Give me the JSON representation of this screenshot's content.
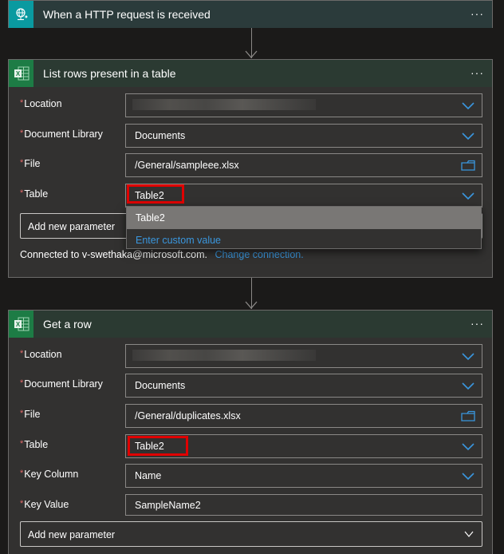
{
  "trigger": {
    "title": "When a HTTP request is received",
    "icon": "http-request-icon",
    "accent": "#0a9aa0",
    "more_label": "···"
  },
  "list_rows": {
    "title": "List rows present in a table",
    "icon": "excel-icon",
    "accent": "#1d7c45",
    "more_label": "···",
    "fields": {
      "location": {
        "label": "Location",
        "value": ""
      },
      "document_library": {
        "label": "Document Library",
        "value": "Documents"
      },
      "file": {
        "label": "File",
        "value": "/General/sampleee.xlsx"
      },
      "table": {
        "label": "Table",
        "value": "Table2"
      }
    },
    "dropdown": {
      "options": [
        "Table2"
      ],
      "custom": "Enter custom value"
    },
    "add_parameter": "Add new parameter",
    "connected_text": "Connected to v-swethaka@microsoft.com.",
    "change_connection": "Change connection."
  },
  "get_row": {
    "title": "Get a row",
    "icon": "excel-icon",
    "accent": "#1d7c45",
    "more_label": "···",
    "fields": {
      "location": {
        "label": "Location",
        "value": ""
      },
      "document_library": {
        "label": "Document Library",
        "value": "Documents"
      },
      "file": {
        "label": "File",
        "value": "/General/duplicates.xlsx"
      },
      "table": {
        "label": "Table",
        "value": "Table2"
      },
      "key_column": {
        "label": "Key Column",
        "value": "Name"
      },
      "key_value": {
        "label": "Key Value",
        "value": "SampleName2"
      }
    },
    "add_parameter": "Add new parameter"
  },
  "required_mark": "*",
  "colors": {
    "link": "#3a96dd",
    "highlight": "#e00000",
    "required": "#e06a6a"
  }
}
